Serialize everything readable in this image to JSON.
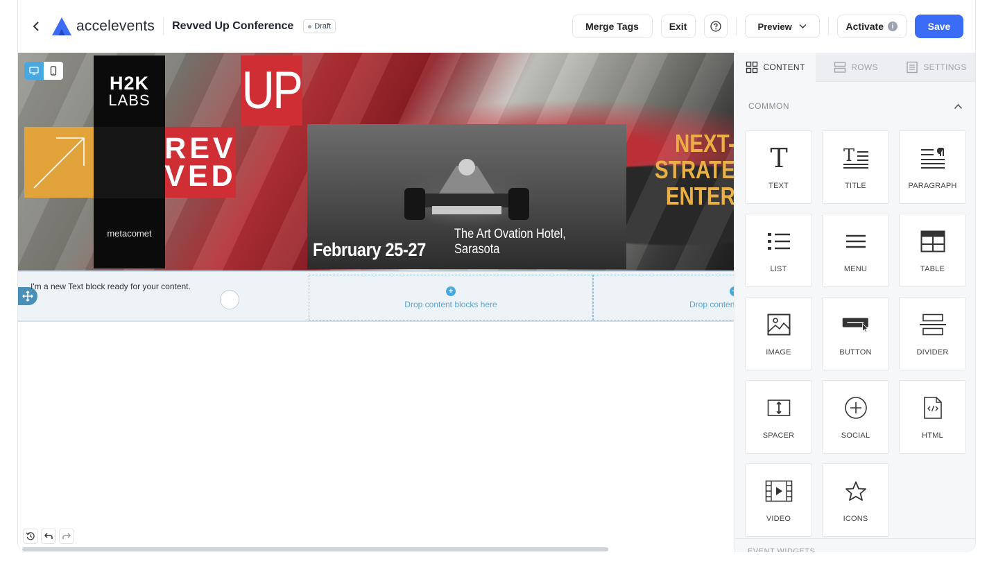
{
  "header": {
    "logo_text": "accelevents",
    "event_title": "Revved Up Conference",
    "status_badge": "Draft",
    "merge_tags_label": "Merge Tags",
    "exit_label": "Exit",
    "preview_label": "Preview",
    "activate_label": "Activate",
    "save_label": "Save"
  },
  "banner": {
    "h2k_line1": "H2K",
    "h2k_line2": "LABS",
    "up_text": "UP",
    "revved_line1": "REV",
    "revved_line2": "VED",
    "metacomet": "metacomet",
    "date": "February 25-27",
    "venue": "The Art Ovation Hotel, Sarasota",
    "side_line1": "NEXT-",
    "side_line2": "STRATE",
    "side_line3": "ENTER"
  },
  "row": {
    "text_block": "I'm a new Text block ready for your content.",
    "drop_label_1": "Drop content blocks here",
    "drop_label_2": "Drop conten"
  },
  "panel": {
    "tabs": [
      {
        "label": "CONTENT",
        "icon": "grid-icon"
      },
      {
        "label": "ROWS",
        "icon": "rows-icon"
      },
      {
        "label": "SETTINGS",
        "icon": "settings-icon"
      }
    ],
    "section_title": "COMMON",
    "blocks": [
      {
        "label": "TEXT",
        "icon": "text-icon"
      },
      {
        "label": "TITLE",
        "icon": "title-icon"
      },
      {
        "label": "PARAGRAPH",
        "icon": "paragraph-icon"
      },
      {
        "label": "LIST",
        "icon": "list-icon"
      },
      {
        "label": "MENU",
        "icon": "menu-icon"
      },
      {
        "label": "TABLE",
        "icon": "table-icon"
      },
      {
        "label": "IMAGE",
        "icon": "image-icon"
      },
      {
        "label": "BUTTON",
        "icon": "button-icon"
      },
      {
        "label": "DIVIDER",
        "icon": "divider-icon"
      },
      {
        "label": "SPACER",
        "icon": "spacer-icon"
      },
      {
        "label": "SOCIAL",
        "icon": "social-icon"
      },
      {
        "label": "HTML",
        "icon": "html-icon"
      },
      {
        "label": "VIDEO",
        "icon": "video-icon"
      },
      {
        "label": "ICONS",
        "icon": "star-icon"
      }
    ],
    "next_section_title": "EVENT WIDGETS"
  },
  "colors": {
    "accent": "#3b6cf5",
    "banner_red": "#cf2e34",
    "banner_orange": "#e2a43a",
    "drop_blue": "#4aa8e0"
  }
}
